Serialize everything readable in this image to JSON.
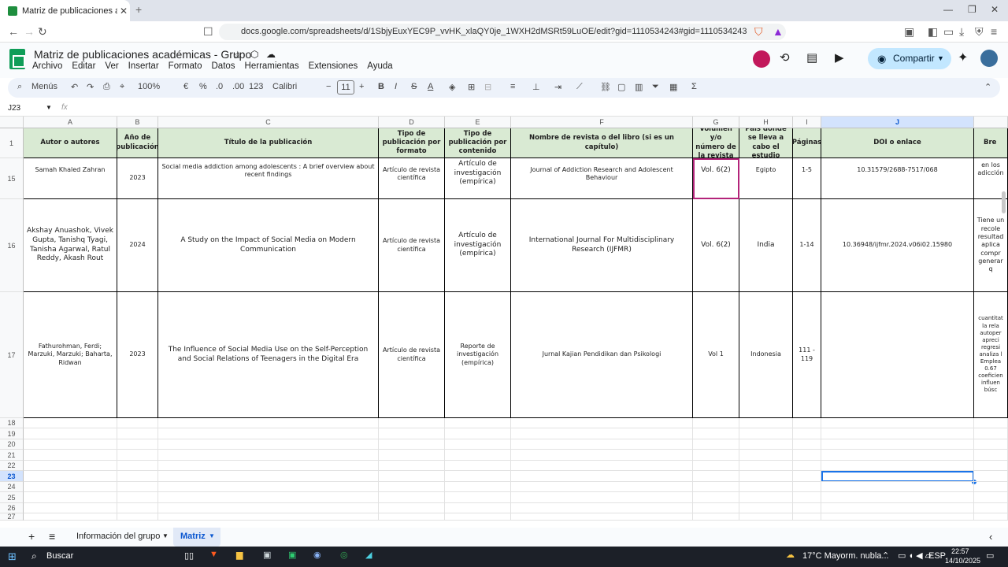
{
  "browser": {
    "tab_title": "Matriz de publicaciones académicas",
    "new_tab": "+",
    "url": "docs.google.com/spreadsheets/d/1SbjyEuxYEC9P_vvHK_xlaQY0je_1WXH2dMSRt59LuOE/edit?gid=1110534243#gid=1110534243"
  },
  "app": {
    "title": "Matriz de publicaciones académicas - Grupo",
    "menus": [
      "Archivo",
      "Editar",
      "Ver",
      "Insertar",
      "Formato",
      "Datos",
      "Herramientas",
      "Extensiones",
      "Ayuda"
    ],
    "share_label": "Compartir"
  },
  "toolbar": {
    "menus_label": "Menús",
    "zoom": "100%",
    "currency": "€",
    "percent": "%",
    "dec_less": ".0",
    "dec_more": ".00",
    "number_format": "123",
    "font": "Calibri",
    "font_size": "11"
  },
  "formula": {
    "cell_ref": "J23",
    "fx": "fx"
  },
  "columns": [
    "A",
    "B",
    "C",
    "D",
    "E",
    "F",
    "G",
    "H",
    "I",
    "J",
    "K"
  ],
  "headers": [
    "Autor o autores",
    "Año de publicación",
    "Título de la publicación",
    "Tipo de publicación por formato",
    "Tipo de publicación por contenido",
    "Nombre de revista o del libro (si es un capítulo)",
    "Volumen y/o número de la revista",
    "País donde se lleva a cabo el estudio",
    "Páginas",
    "DOI o enlace",
    "Bre"
  ],
  "row_numbers": [
    "1",
    "15",
    "16",
    "17",
    "18",
    "19",
    "20",
    "21",
    "22",
    "23",
    "24",
    "25",
    "26",
    "27"
  ],
  "rows": [
    {
      "author": "Samah Khaled Zahran",
      "year": "2023",
      "title": "Social media addiction among adolescents : A brief overview about recent findings",
      "format": "Artículo de revista científica",
      "content": "Artículo de investigación (empírica)",
      "journal": "Journal of Addiction Research and Adolescent Behaviour",
      "volume": "Vol. 6(2)",
      "country": "Egipto",
      "pages": "1-5",
      "doi": "10.31579/2688-7517/068",
      "extra": "en los adicción"
    },
    {
      "author": "Akshay Anuashok, Vivek Gupta, Tanishq Tyagi, Tanisha Agarwal, Ratul Reddy, Akash Rout",
      "year": "2024",
      "title": "A Study on the Impact of Social Media on Modern Communication",
      "format": "Artículo de revista científica",
      "content": "Artículo de investigación (empírica)",
      "journal": "International Journal For Multidisciplinary Research (IJFMR)",
      "volume": "Vol. 6(2)",
      "country": "India",
      "pages": "1-14",
      "doi": "10.36948/ijfmr.2024.v06i02.15980",
      "extra": "Tiene un recole resultad aplica compr generar q"
    },
    {
      "author": "Fathurohman, Ferdi; Marzuki, Marzuki; Baharta, Ridwan",
      "year": "2023",
      "title": "The Influence of Social Media Use on the Self-Perception and Social Relations of Teenagers in the Digital Era",
      "format": "Artículo de revista científica",
      "content": "Reporte de investigación (empírica)",
      "journal": "Jurnal Kajian Pendidikan dan Psikologi",
      "volume": "Vol 1",
      "country": "Indonesia",
      "pages": "111 - 119",
      "doi": "",
      "extra": "cuantitat la rela autoper apreci regresi analiza l Emplea 0.67 coeficien influen búsc"
    }
  ],
  "sheets": {
    "tab1": "Información del grupo",
    "tab2": "Matriz"
  },
  "taskbar": {
    "search": "Buscar",
    "weather": "17°C  Mayorm. nubla...",
    "lang": "ESP",
    "time": "22:57",
    "date": "14/10/2025"
  }
}
